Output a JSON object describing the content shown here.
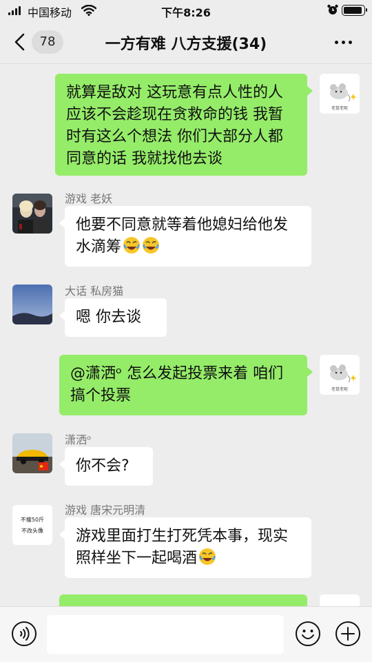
{
  "status_bar": {
    "carrier": "中国移动",
    "time": "下午8:26"
  },
  "header": {
    "back_count": "78",
    "title": "一方有难 八方支援(34)"
  },
  "messages": [
    {
      "direction": "out",
      "text": "就算是敌对 这玩意有点人性的人应该不会趁现在贪救命的钱 我暂时有这么个想法 你们大部分人都同意的话 我就找他去谈"
    },
    {
      "direction": "in",
      "sender": "游戏 老妖",
      "text": "他要不同意就等着他媳妇给他发水滴筹",
      "emoji_count": 2
    },
    {
      "direction": "in",
      "sender": "大话 私房猫",
      "text": "嗯  你去谈"
    },
    {
      "direction": "out",
      "text": "@潇洒ᵒ 怎么发起投票来着 咱们搞个投票"
    },
    {
      "direction": "in",
      "sender": "潇洒ᵒ",
      "text": "你不会?"
    },
    {
      "direction": "in",
      "sender": "游戏 唐宋元明清",
      "text": "游戏里面打生打死凭本事，现实照样坐下一起喝酒",
      "emoji_count": 1
    }
  ],
  "avatars": {
    "self_caption": "老鼠老呢",
    "tsy_line1": "不瘦50斤",
    "tsy_line2": "不改头像"
  },
  "input_bar": {
    "placeholder": ""
  }
}
